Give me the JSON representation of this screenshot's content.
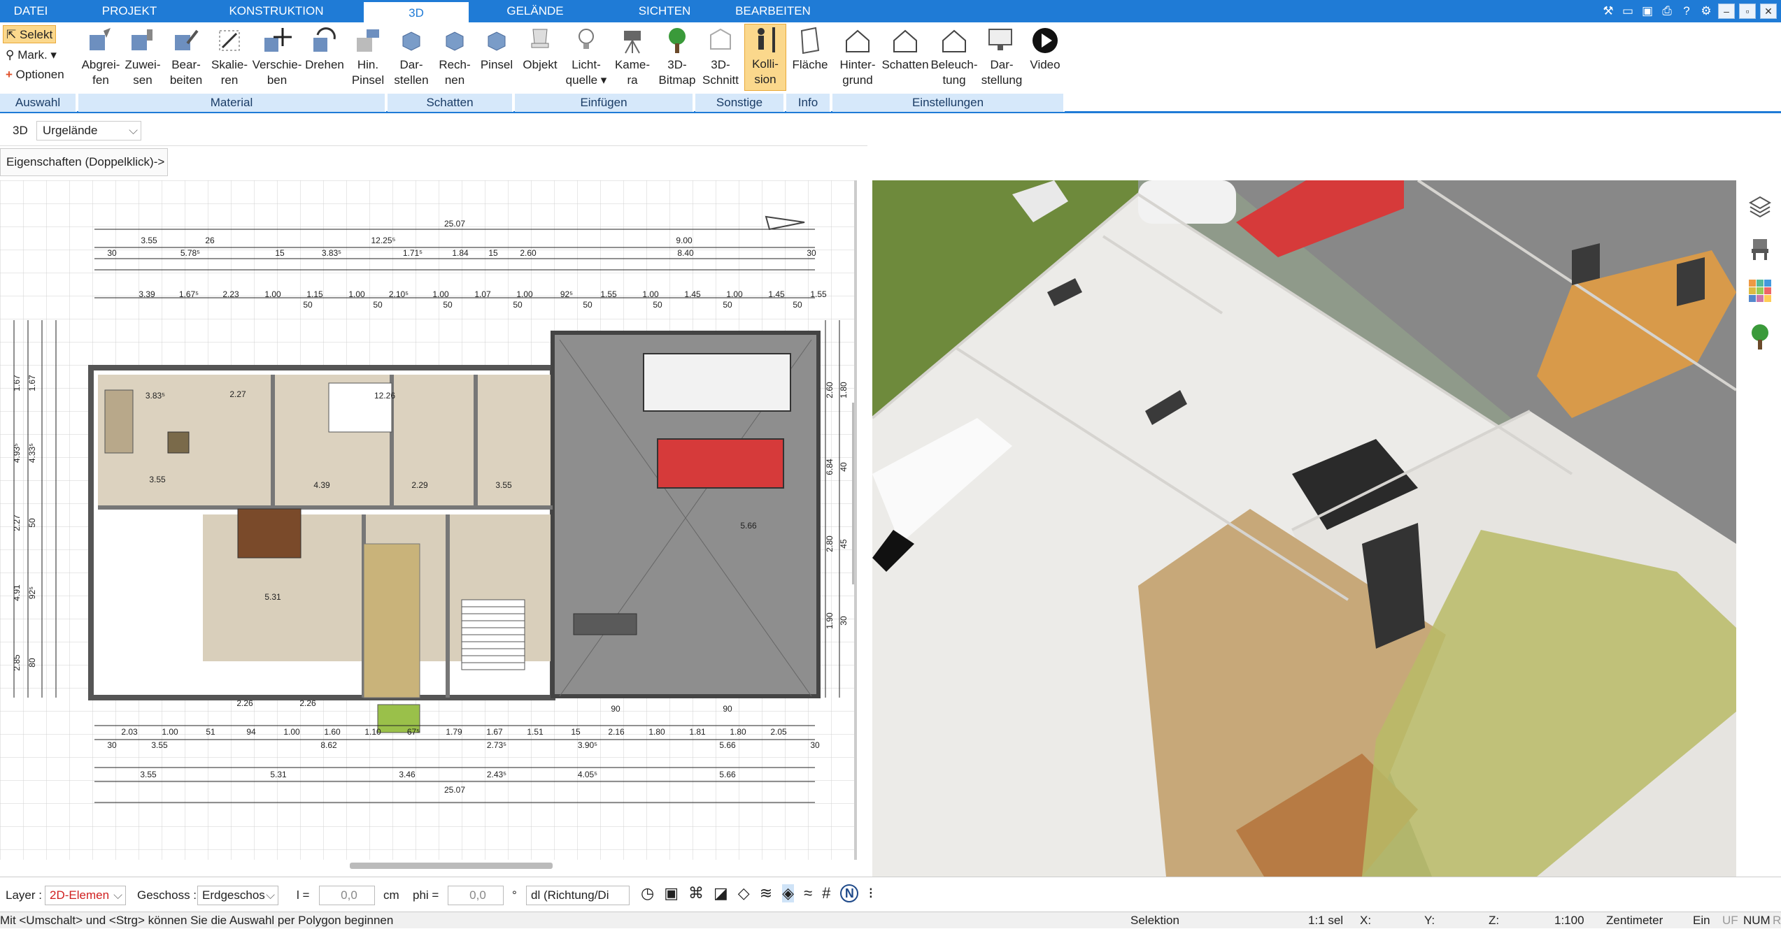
{
  "tabs": [
    "DATEI",
    "PROJEKT",
    "KONSTRUKTION",
    "3D",
    "GELÄNDE",
    "SICHTEN",
    "BEARBEITEN"
  ],
  "active_tab": "3D",
  "window": {
    "minimize": "–",
    "restore": "▫",
    "close": "✕"
  },
  "ribbon": {
    "auswahl": {
      "select": "Selekt",
      "mark": "Mark.",
      "options": "Optionen",
      "label": "Auswahl"
    },
    "material": {
      "label": "Material",
      "buttons": [
        [
          "Abgrei-",
          "fen"
        ],
        [
          "Zuwei-",
          "sen"
        ],
        [
          "Bear-",
          "beiten"
        ],
        [
          "Skalie-",
          "ren"
        ],
        [
          "Verschie-",
          "ben"
        ],
        [
          "Drehen",
          ""
        ],
        [
          "Hin.",
          "Pinsel"
        ]
      ]
    },
    "schatten": {
      "label": "Schatten",
      "buttons": [
        [
          "Dar-",
          "stellen"
        ],
        [
          "Rech-",
          "nen"
        ],
        [
          "Pinsel",
          ""
        ]
      ]
    },
    "einfuegen": {
      "label": "Einfügen",
      "buttons": [
        [
          "Objekt",
          ""
        ],
        [
          "Licht-",
          "quelle ▾"
        ],
        [
          "Kame-",
          "ra"
        ],
        [
          "3D-",
          "Bitmap"
        ]
      ]
    },
    "sonstige": {
      "label": "Sonstige",
      "buttons": [
        [
          "3D-",
          "Schnitt"
        ],
        [
          "Kolli-",
          "sion"
        ]
      ]
    },
    "info": {
      "label": "Info",
      "buttons": [
        [
          "Fläche",
          ""
        ]
      ]
    },
    "einstellungen": {
      "label": "Einstellungen",
      "buttons": [
        [
          "Hinter-",
          "grund"
        ],
        [
          "Schatten",
          ""
        ],
        [
          "Beleuch-",
          "tung"
        ],
        [
          "Dar-",
          "stellung"
        ],
        [
          "Video",
          ""
        ]
      ]
    }
  },
  "optbar": {
    "mode": "3D",
    "terrain": "Urgelände"
  },
  "properties_hint": "Eigenschaften (Doppelklick)->",
  "plan": {
    "top_dims": [
      "25.07",
      "3.55",
      "26",
      "12.25⁵",
      "9.00",
      "30",
      "5.78⁵",
      "15",
      "3.83⁵",
      "1.71⁵",
      "1.84",
      "15",
      "2.60",
      "8.40",
      "30"
    ],
    "row3": [
      "3.39",
      "1.67⁵",
      "2.23",
      "1.00",
      "1.15",
      "1.00",
      "2.10⁵",
      "1.00",
      "1.07",
      "1.00",
      "92⁵",
      "1.55",
      "1.00",
      "1.45",
      "1.00",
      "1.45",
      "1.55"
    ],
    "row3b": [
      "50",
      "50",
      "50",
      "50",
      "50",
      "50",
      "50",
      "50"
    ],
    "bottom_dims": [
      "2.03",
      "1.00",
      "51",
      "94",
      "1.00",
      "1.60",
      "1.10",
      "67⁵",
      "1.79",
      "1.67",
      "1.51",
      "15",
      "2.16",
      "1.80",
      "1.81",
      "1.80",
      "2.05"
    ],
    "bottom_dims2": [
      "30",
      "3.55",
      "8.62",
      "2.73⁵",
      "3.90⁵",
      "5.66",
      "30"
    ],
    "bottom_dims3": [
      "3.55",
      "5.31",
      "3.46",
      "2.43⁵",
      "4.05⁵",
      "5.66"
    ],
    "total": "25.07",
    "inner": [
      "3.83⁵",
      "12.26",
      "2.27",
      "3.55",
      "4.39",
      "2.29",
      "3.55",
      "5.31",
      "5.66",
      "2.26",
      "2.26",
      "90",
      "90"
    ]
  },
  "bottom": {
    "layer_label": "Layer :",
    "layer_value": "2D-Elemen",
    "geschoss_label": "Geschoss :",
    "geschoss_value": "Erdgeschos",
    "l_label": "l =",
    "l_value": "0,0",
    "l_unit": "cm",
    "phi_label": "phi =",
    "phi_value": "0,0",
    "phi_unit": "°",
    "dl_value": "dl (Richtung/Di"
  },
  "status": {
    "hint": "Mit <Umschalt> und <Strg> können Sie die Auswahl per Polygon beginnen",
    "mode": "Selektion",
    "scale_sel": "1:1 sel",
    "x": "X:",
    "y": "Y:",
    "z": "Z:",
    "scale": "1:100",
    "unit": "Zentimeter",
    "ein": "Ein",
    "uf": "UF",
    "num": "NUM",
    "ri": "RI"
  },
  "colors": {
    "accent": "#1f7bd6",
    "group_bg": "#d6e8fa",
    "selected": "#fbd88c"
  }
}
